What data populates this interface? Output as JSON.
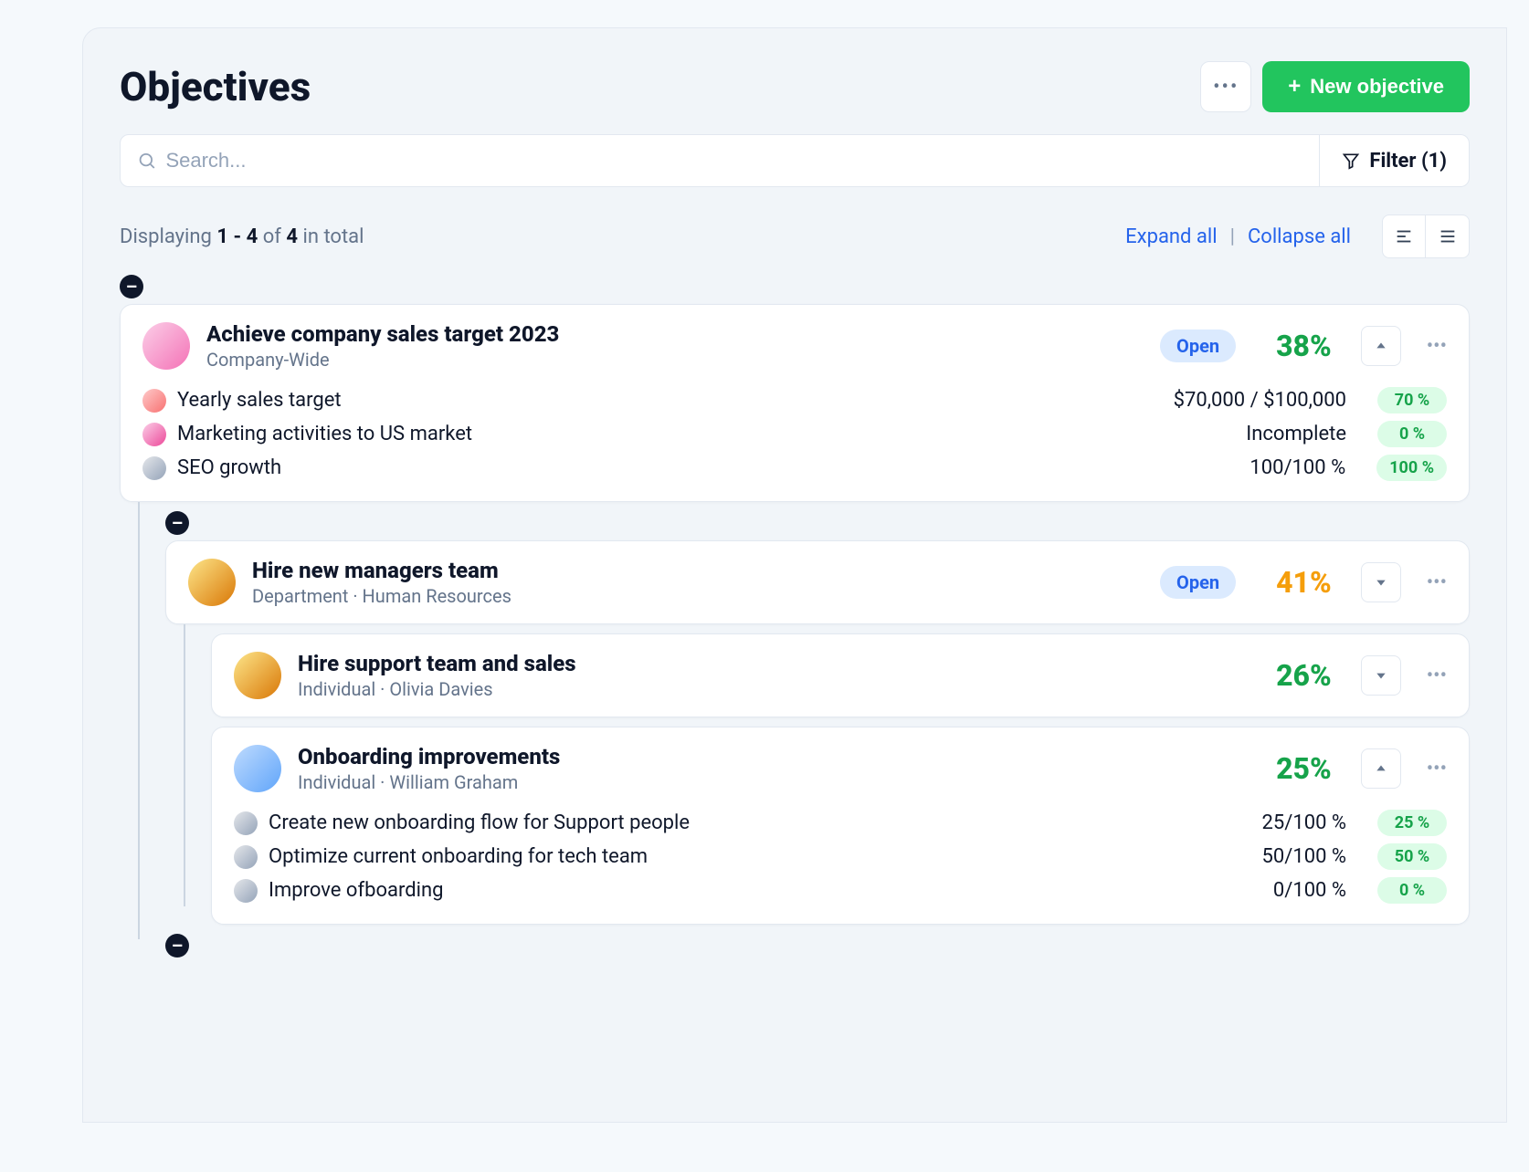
{
  "page_title": "Objectives",
  "actions": {
    "new_objective": "New objective"
  },
  "search": {
    "placeholder": "Search..."
  },
  "filter": {
    "label": "Filter (1)"
  },
  "display": {
    "prefix": "Displaying",
    "range": "1 - 4",
    "of": "of",
    "total": "4",
    "suffix": "in total"
  },
  "expand_all": "Expand all",
  "collapse_all": "Collapse all",
  "badges": {
    "open": "Open"
  },
  "objectives": [
    {
      "title": "Achieve company sales target 2023",
      "subtitle": "Company-Wide",
      "percent": "38%",
      "percent_color": "green",
      "status": "Open",
      "key_results": [
        {
          "name": "Yearly sales target",
          "value": "$70,000 / $100,000",
          "pct": "70 %"
        },
        {
          "name": "Marketing activities to US market",
          "value": "Incomplete",
          "pct": "0 %"
        },
        {
          "name": "SEO growth",
          "value": "100/100 %",
          "pct": "100 %"
        }
      ],
      "children": [
        {
          "title": "Hire new managers team",
          "subtitle": "Department · Human Resources",
          "percent": "41%",
          "percent_color": "yellow",
          "status": "Open",
          "children": [
            {
              "title": "Hire support team and sales",
              "subtitle": "Individual · Olivia Davies",
              "percent": "26%",
              "percent_color": "green"
            },
            {
              "title": "Onboarding improvements",
              "subtitle": "Individual · William Graham",
              "percent": "25%",
              "percent_color": "green",
              "key_results": [
                {
                  "name": "Create new onboarding flow for Support people",
                  "value": "25/100 %",
                  "pct": "25 %"
                },
                {
                  "name": "Optimize current onboarding for tech team",
                  "value": "50/100 %",
                  "pct": "50 %"
                },
                {
                  "name": "Improve ofboarding",
                  "value": "0/100 %",
                  "pct": "0 %"
                }
              ]
            }
          ]
        }
      ]
    }
  ]
}
